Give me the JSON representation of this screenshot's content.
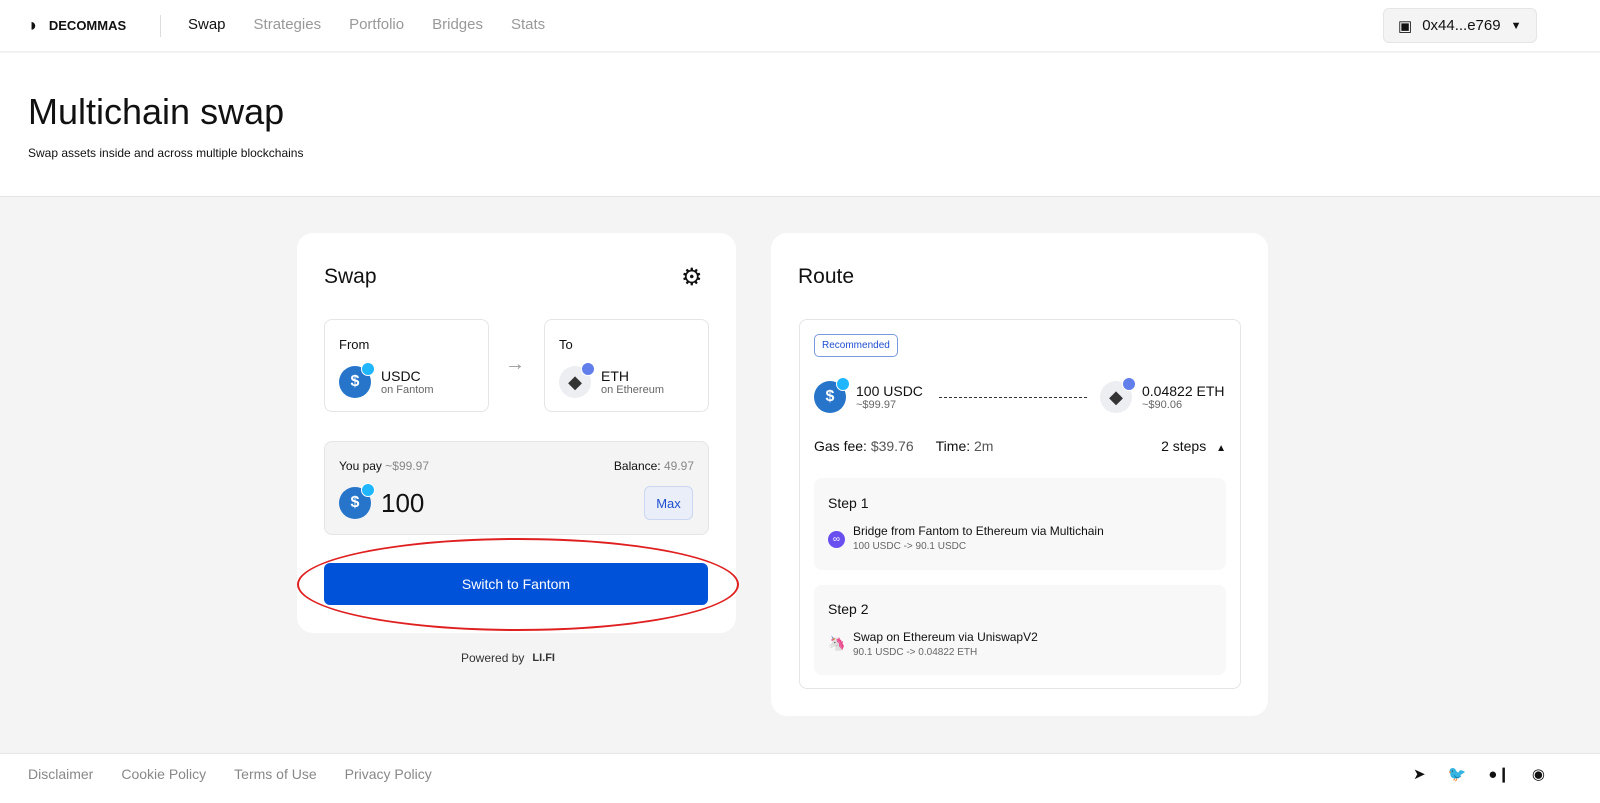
{
  "header": {
    "brand": "DECOMMAS",
    "nav": [
      "Swap",
      "Strategies",
      "Portfolio",
      "Bridges",
      "Stats"
    ],
    "wallet": "0x44...e769"
  },
  "hero": {
    "title": "Multichain swap",
    "subtitle": "Swap assets inside and across multiple blockchains"
  },
  "swap": {
    "title": "Swap",
    "from_label": "From",
    "from_token": "USDC",
    "from_chain": "on Fantom",
    "to_label": "To",
    "to_token": "ETH",
    "to_chain": "on Ethereum",
    "you_pay": "You pay",
    "pay_usd": "~$99.97",
    "balance_label": "Balance:",
    "balance": "49.97",
    "amount": "100",
    "max": "Max",
    "button": "Switch to Fantom",
    "powered": "Powered by",
    "powered_brand": "LI.FI"
  },
  "route": {
    "title": "Route",
    "recommended": "Recommended",
    "from_amount": "100 USDC",
    "from_usd": "~$99.97",
    "to_amount": "0.04822 ETH",
    "to_usd": "~$90.06",
    "gas_label": "Gas fee:",
    "gas": "$39.76",
    "time_label": "Time:",
    "time": "2m",
    "steps_label": "2 steps",
    "steps": [
      {
        "title": "Step 1",
        "desc": "Bridge from Fantom to Ethereum via Multichain",
        "detail": "100 USDC -> 90.1 USDC"
      },
      {
        "title": "Step 2",
        "desc": "Swap on Ethereum via UniswapV2",
        "detail": "90.1 USDC -> 0.04822 ETH"
      }
    ]
  },
  "footer": {
    "links": [
      "Disclaimer",
      "Cookie Policy",
      "Terms of Use",
      "Privacy Policy"
    ]
  },
  "colors": {
    "primary": "#0052d9",
    "annotation": "#e02020"
  }
}
